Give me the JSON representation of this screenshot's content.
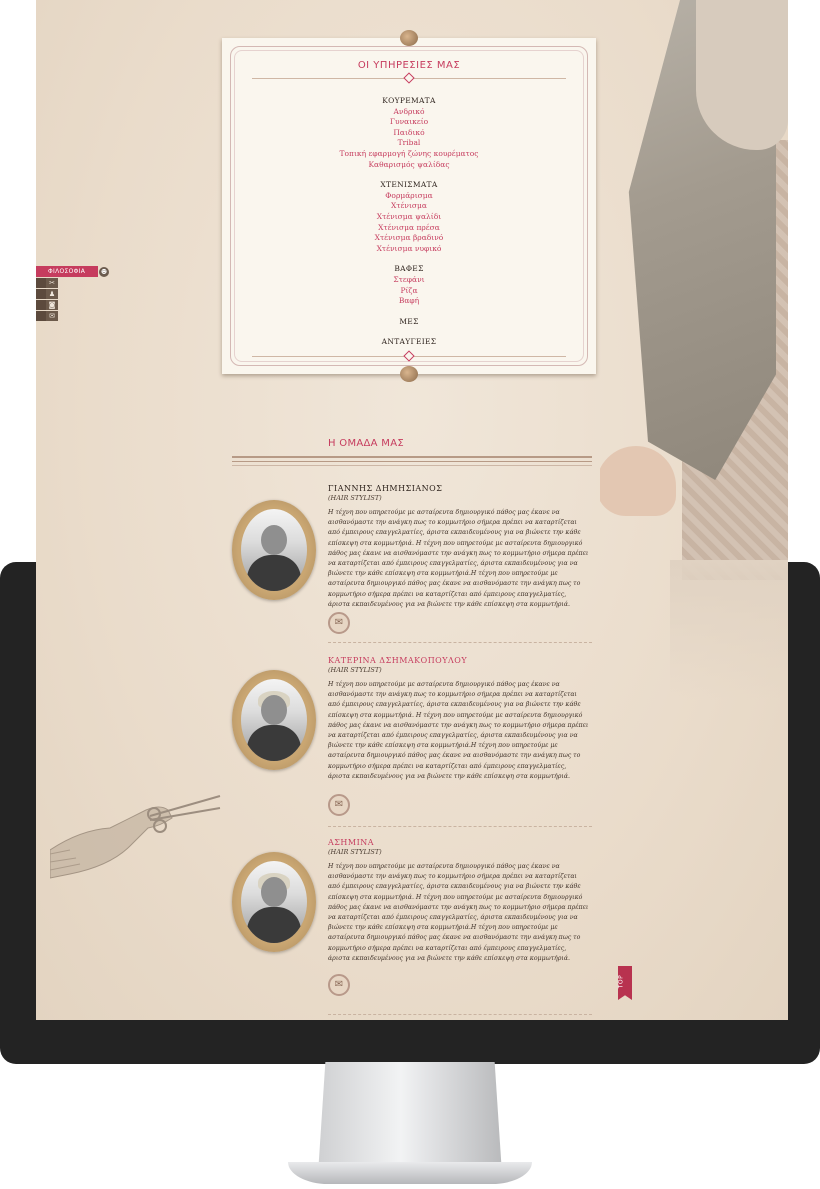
{
  "sidenav": {
    "active_label": "ΦΙΛΟΣΟΦΙΑ",
    "icons": [
      "scissors-icon",
      "team-icon",
      "camera-icon",
      "mail-icon"
    ]
  },
  "services": {
    "title": "ΟΙ ΥΠΗΡΕΣΙΕΣ ΜΑΣ",
    "groups": [
      {
        "heading": "ΚΟΥΡΕΜΑΤΑ",
        "items": [
          "Ανδρικό",
          "Γυναικείο",
          "Παιδικό",
          "Tribal",
          "Τοπική εφαρμογή ζώνης κουρέματος",
          "Καθαρισμός ψαλίδας"
        ]
      },
      {
        "heading": "ΧΤΕΝΙΣΜΑΤΑ",
        "items": [
          "Φορμάρισμα",
          "Χτένισμα",
          "Χτένισμα ψαλίδι",
          "Χτένισμα πρέσα",
          "Χτένισμα βραδινό",
          "Χτένισμα νυφικό"
        ]
      },
      {
        "heading": "ΒΑΦΕΣ",
        "items": [
          "Στεφάνι",
          "Ρίζα",
          "Βαφή"
        ]
      },
      {
        "heading": "ΜΕΣ",
        "items": []
      },
      {
        "heading": "ΑΝΤΑΥΓΕΙΕΣ",
        "items": []
      }
    ]
  },
  "team": {
    "title": "Η ΟΜΑΔΑ ΜΑΣ",
    "members": [
      {
        "name": "ΓΙΑΝΝΗΣ ΔΗΜΗΣΙΑΝΟΣ",
        "role": "(HAIR STYLIST)",
        "bio": "Η τέχνη που υπηρετούμε με ασταίρευτα δημιουργικό πάθος μας έκανε να αισθανόμαστε την ανάγκη πως το κομμωτήριο σήμερα πρέπει να καταρτίζεται από έμπειρους επαγγελματίες, άριστα εκπαιδευμένους για να βιώνετε την κάθε επίσκεψη στα κομμωτήριά. Η τέχνη που υπηρετούμε με ασταίρευτα δημιουργικό πάθος μας έκανε να αισθανόμαστε την ανάγκη πως το κομμωτήριο σήμερα πρέπει να καταρτίζεται από έμπειρους επαγγελματίες, άριστα εκπαιδευμένους για να βιώνετε την κάθε επίσκεψη στα κομμωτήριά.Η τέχνη που υπηρετούμε με ασταίρευτα δημιουργικό πάθος μας έκανε να αισθανόμαστε την ανάγκη πως το κομμωτήριο σήμερα πρέπει να καταρτίζεται από έμπειρους επαγγελματίες, άριστα εκπαιδευμένους για να βιώνετε την κάθε επίσκεψη στα κομμωτήριά."
      },
      {
        "name": "ΚΑΤΕΡΙΝΑ ΔΣΗΜΑΚΟΠΟΥΛΟΥ",
        "role": "(HAIR STYLIST)",
        "bio": "Η τέχνη που υπηρετούμε με ασταίρευτα δημιουργικό πάθος μας έκανε να αισθανόμαστε την ανάγκη πως το κομμωτήριο σήμερα πρέπει να καταρτίζεται από έμπειρους επαγγελματίες, άριστα εκπαιδευμένους για να βιώνετε την κάθε επίσκεψη στα κομμωτήριά. Η τέχνη που υπηρετούμε με ασταίρευτα δημιουργικό πάθος μας έκανε να αισθανόμαστε την ανάγκη πως το κομμωτήριο σήμερα πρέπει να καταρτίζεται από έμπειρους επαγγελματίες, άριστα εκπαιδευμένους για να βιώνετε την κάθε επίσκεψη στα κομμωτήριά.Η τέχνη που υπηρετούμε με ασταίρευτα δημιουργικό πάθος μας έκανε να αισθανόμαστε την ανάγκη πως το κομμωτήριο σήμερα πρέπει να καταρτίζεται από έμπειρους επαγγελματίες, άριστα εκπαιδευμένους για να βιώνετε την κάθε επίσκεψη στα κομμωτήριά."
      },
      {
        "name": "ΑΣΗΜΙΝΑ",
        "role": "(HAIR STYLIST)",
        "bio": "Η τέχνη που υπηρετούμε με ασταίρευτα δημιουργικό πάθος μας έκανε να αισθανόμαστε την ανάγκη πως το κομμωτήριο σήμερα πρέπει να καταρτίζεται από έμπειρους επαγγελματίες, άριστα εκπαιδευμένους για να βιώνετε την κάθε επίσκεψη στα κομμωτήριά. Η τέχνη που υπηρετούμε με ασταίρευτα δημιουργικό πάθος μας έκανε να αισθανόμαστε την ανάγκη πως το κομμωτήριο σήμερα πρέπει να καταρτίζεται από έμπειρους επαγγελματίες, άριστα εκπαιδευμένους για να βιώνετε την κάθε επίσκεψη στα κομμωτήριά.Η τέχνη που υπηρετούμε με ασταίρευτα δημιουργικό πάθος μας έκανε να αισθανόμαστε την ανάγκη πως το κομμωτήριο σήμερα πρέπει να καταρτίζεται από έμπειρους επαγγελματίες, άριστα εκπαιδευμένους για να βιώνετε την κάθε επίσκεψη στα κομμωτήριά."
      }
    ]
  },
  "top_button": "TOP",
  "colors": {
    "accent": "#c63c5e",
    "paper": "#eadccb",
    "frame": "#232323"
  }
}
